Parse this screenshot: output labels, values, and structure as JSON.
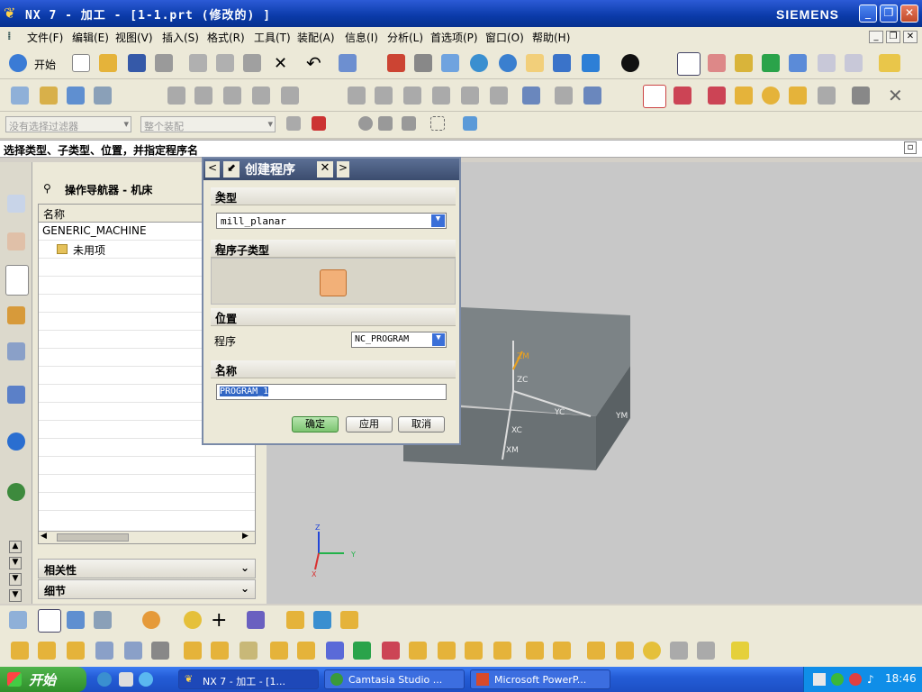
{
  "window": {
    "title": "NX 7 - 加工 - [1-1.prt (修改的) ]",
    "brand": "SIEMENS",
    "controls": [
      "_",
      "❐",
      "✕"
    ]
  },
  "menubar": {
    "items": [
      "文件(F)",
      "编辑(E)",
      "视图(V)",
      "插入(S)",
      "格式(R)",
      "工具(T)",
      "装配(A)",
      "信息(I)",
      "分析(L)",
      "首选项(P)",
      "窗口(O)",
      "帮助(H)"
    ]
  },
  "toolbar": {
    "start_label": "开始"
  },
  "filterbar": {
    "filter_select": "没有选择过滤器",
    "assembly_select": "整个装配"
  },
  "cue": {
    "text": "选择类型、子类型、位置，并指定程序名"
  },
  "navigator": {
    "title": "操作导航器 - 机床",
    "column_name": "名称",
    "rows": [
      {
        "label": "GENERIC_MACHINE"
      },
      {
        "label": "未用项"
      }
    ],
    "related_panel": "相关性",
    "details_panel": "细节"
  },
  "dialog": {
    "title": "创建程序",
    "sections": {
      "type": "类型",
      "subtype": "程序子类型",
      "location": "位置",
      "name": "名称"
    },
    "type_value": "mill_planar",
    "program_label": "程序",
    "program_value": "NC_PROGRAM",
    "name_value": "PROGRAM_1",
    "buttons": {
      "ok": "确定",
      "apply": "应用",
      "cancel": "取消"
    }
  },
  "viewport": {
    "wcs_labels": [
      "ZM",
      "ZC",
      "YC",
      "XC",
      "XM",
      "YM"
    ],
    "triad_labels": [
      "Z",
      "Y",
      "X"
    ]
  },
  "taskbar": {
    "start": "开始",
    "tasks": [
      "NX 7 - 加工 - [1...",
      "Camtasia Studio ...",
      "Microsoft PowerP..."
    ],
    "clock": "18:46"
  },
  "colors": {
    "titlebar": "#0a3aa8",
    "dialog_ok": "#8fd08a",
    "part": "#6e7578"
  }
}
